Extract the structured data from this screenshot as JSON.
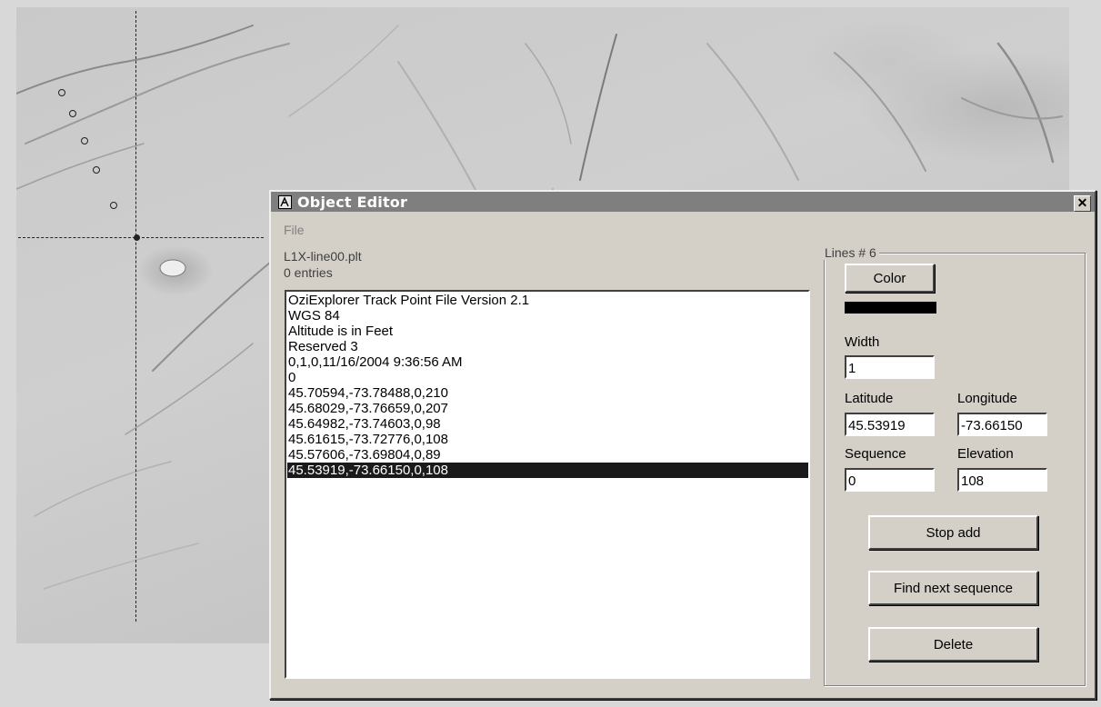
{
  "dialog": {
    "title": "Object Editor",
    "close_label": "✕",
    "menu_file": "File",
    "filename": "L1X-line00.plt",
    "entries": "0 entries",
    "list_items": [
      "OziExplorer Track Point File Version 2.1",
      "WGS 84",
      "Altitude is in Feet",
      "Reserved 3",
      "0,1,0,11/16/2004 9:36:56 AM",
      "0",
      "45.70594,-73.78488,0,210",
      "45.68029,-73.76659,0,207",
      "45.64982,-73.74603,0,98",
      "45.61615,-73.72776,0,108",
      "45.57606,-73.69804,0,89",
      "45.53919,-73.66150,0,108"
    ],
    "selected_index": 11
  },
  "lines_group": {
    "legend": "Lines # 6",
    "color_button": "Color",
    "swatch_color": "#000000",
    "width_label": "Width",
    "width_value": "1",
    "latitude_label": "Latitude",
    "latitude_value": "45.53919",
    "longitude_label": "Longitude",
    "longitude_value": "-73.66150",
    "sequence_label": "Sequence",
    "sequence_value": "0",
    "elevation_label": "Elevation",
    "elevation_value": "108",
    "stop_add_button": "Stop add",
    "find_next_button": "Find next sequence",
    "delete_button": "Delete"
  },
  "map": {
    "track_point_count": 6,
    "icons": [
      "track-point-marker",
      "crosshair-cursor",
      "app-icon",
      "close-icon"
    ]
  }
}
